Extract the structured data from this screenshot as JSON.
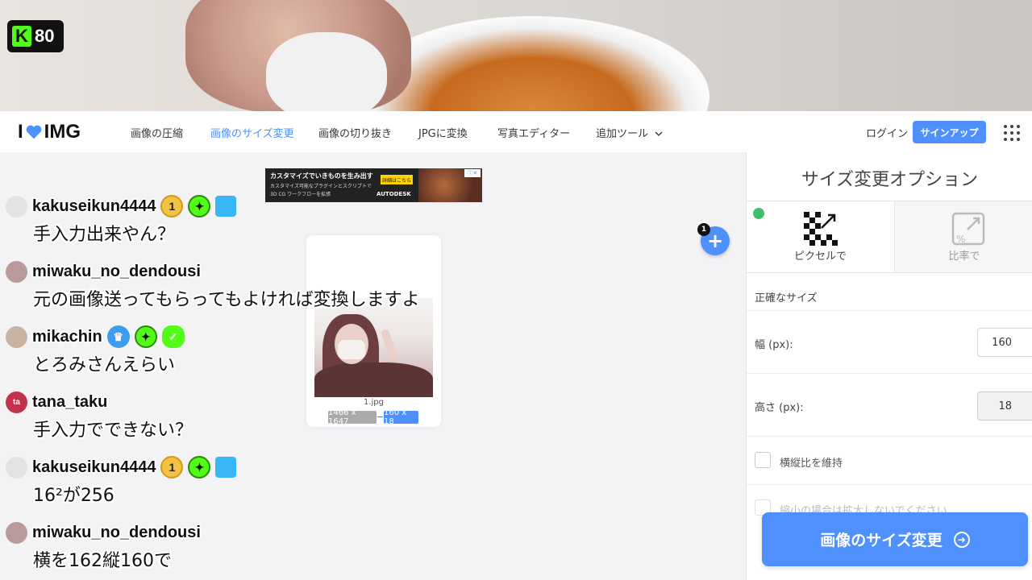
{
  "stream": {
    "viewer_count": "80"
  },
  "nav": {
    "logo_left": "I",
    "logo_right": "IMG",
    "items": [
      "画像の圧縮",
      "画像のサイズ変更",
      "画像の切り抜き",
      "JPGに変換",
      "写真エディター",
      "追加ツール"
    ],
    "login": "ログイン",
    "signup": "サインアップ"
  },
  "ad": {
    "headline": "カスタマイズでいきものを生み出す",
    "sub1": "カスタマイズ可能なプラグインとスクリプトで",
    "sub2": "3D CG ワークフローを拡張",
    "button": "詳細はこちら",
    "brand": "AUTODESK"
  },
  "file": {
    "name": "1.jpg",
    "original_size": "1466 x 1647",
    "new_size": "160 x 18",
    "count": "1"
  },
  "sidebar": {
    "title": "サイズ変更オプション",
    "tab_pixels": "ピクセルで",
    "tab_ratio": "比率で",
    "section": "正確なサイズ",
    "width_label": "幅 (px):",
    "width_value": "160",
    "height_label": "高さ (px):",
    "height_value": "18",
    "keep_ratio": "横縦比を維持",
    "no_enlarge": "縮小の場合は拡大しないでください",
    "resize_button": "画像のサイズ変更"
  },
  "chat": [
    {
      "user": "kakuseikun4444",
      "text": "手入力出来やん？",
      "avatar_color": "#d6d6d6",
      "badges": [
        "1",
        "spark",
        "cube"
      ]
    },
    {
      "user": "miwaku_no_dendousi",
      "text": "元の画像送ってもらってもよければ変換しますよ",
      "avatar_color": "#b89a9a",
      "badges": []
    },
    {
      "user": "mikachin",
      "text": "とろみさんえらい",
      "avatar_color": "#c9b2a0",
      "badges": [
        "crown",
        "spark",
        "verified"
      ]
    },
    {
      "user": "tana_taku",
      "text": "手入力でできない？",
      "avatar_color": "#c2324a",
      "badges": []
    },
    {
      "user": "kakuseikun4444",
      "text": "16²が256",
      "avatar_color": "#d6d6d6",
      "badges": [
        "1",
        "spark",
        "cube"
      ]
    },
    {
      "user": "miwaku_no_dendousi",
      "text": "横を162縦160で",
      "avatar_color": "#b89a9a",
      "badges": []
    }
  ],
  "colors": {
    "accent": "#4d90fe",
    "kick_green": "#53fc18"
  }
}
